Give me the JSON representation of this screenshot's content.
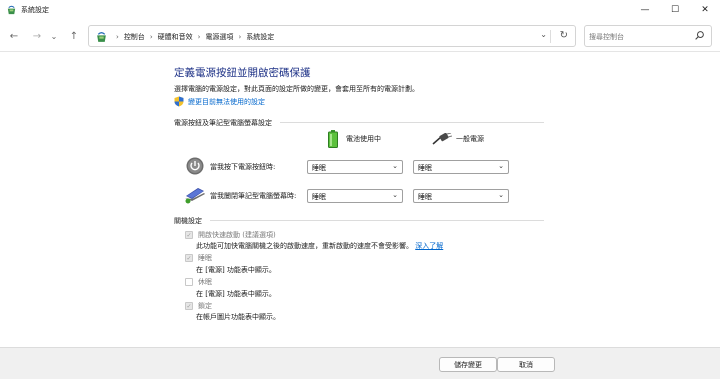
{
  "window": {
    "title": "系統設定",
    "min_glyph": "—",
    "max_glyph": "☐",
    "close_glyph": "✕"
  },
  "nav": {
    "back_glyph": "←",
    "forward_glyph": "→",
    "recent_glyph": "⌄",
    "up_glyph": "↑",
    "breadcrumbs": [
      "控制台",
      "硬體和音效",
      "電源選項",
      "系統設定"
    ],
    "separator": "›",
    "dropdown_glyph": "⌄",
    "refresh_glyph": "↻",
    "search_placeholder": "搜尋控制台"
  },
  "main": {
    "heading": "定義電源按鈕並開啟密碼保護",
    "description": "選擇電腦的電源設定，對此頁面的設定所做的變更，會套用至所有的電源計劃。",
    "change_link": "變更目前無法使用的設定"
  },
  "power_section": {
    "title": "電源按鈕及筆記型電腦螢幕設定",
    "col_battery": "電池使用中",
    "col_plugged": "一般電源",
    "rows": [
      {
        "label": "當我按下電源按鈕時:",
        "battery": "睡眠",
        "plugged": "睡眠"
      },
      {
        "label": "當我闔閉筆記型電腦螢幕時:",
        "battery": "睡眠",
        "plugged": "睡眠"
      }
    ]
  },
  "shutdown_section": {
    "title": "關機設定",
    "items": [
      {
        "label": "開啟快速啟動 (建議選項)",
        "checked": true,
        "desc": "此功能可加快電腦關機之後的啟動速度，重新啟動的速度不會受影響。",
        "link": "深入了解"
      },
      {
        "label": "睡眠",
        "checked": true,
        "desc": "在 [電源] 功能表中顯示。"
      },
      {
        "label": "休眠",
        "checked": false,
        "desc": "在 [電源] 功能表中顯示。"
      },
      {
        "label": "鎖定",
        "checked": true,
        "desc": "在帳戶圖片功能表中顯示。"
      }
    ]
  },
  "footer": {
    "save": "儲存變更",
    "cancel": "取消"
  },
  "colors": {
    "heading": "#1e3287",
    "link": "#0066cc",
    "footer_bg": "#f0f0f0"
  }
}
